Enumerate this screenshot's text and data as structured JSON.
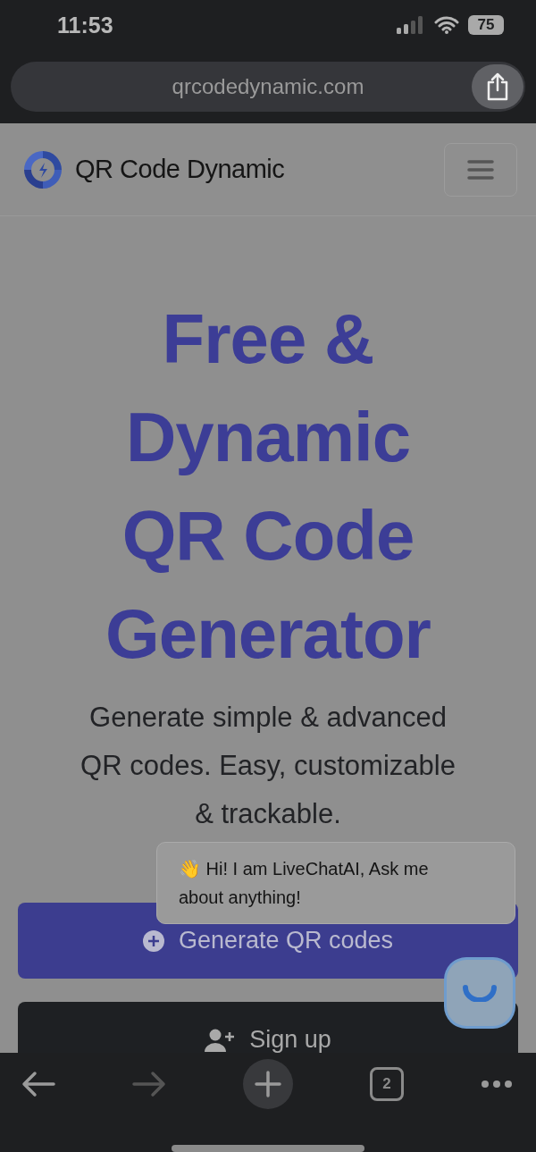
{
  "status_bar": {
    "time": "11:53",
    "battery": "75"
  },
  "browser": {
    "url": "qrcodedynamic.com",
    "tab_count": "2"
  },
  "site": {
    "brand": "QR Code Dynamic",
    "headline": [
      "Free &",
      "Dynamic",
      "QR Code",
      "Generator"
    ],
    "subtitle": "Generate simple & advanced QR codes. Easy, customizable & trackable.",
    "buttons": [
      {
        "kind": "primary",
        "label": "Generate QR codes"
      },
      {
        "kind": "dark",
        "label": "Sign up"
      }
    ]
  },
  "chat": {
    "emoji": "👋",
    "message": "Hi! I am LiveChatAI, Ask me about anything!"
  }
}
